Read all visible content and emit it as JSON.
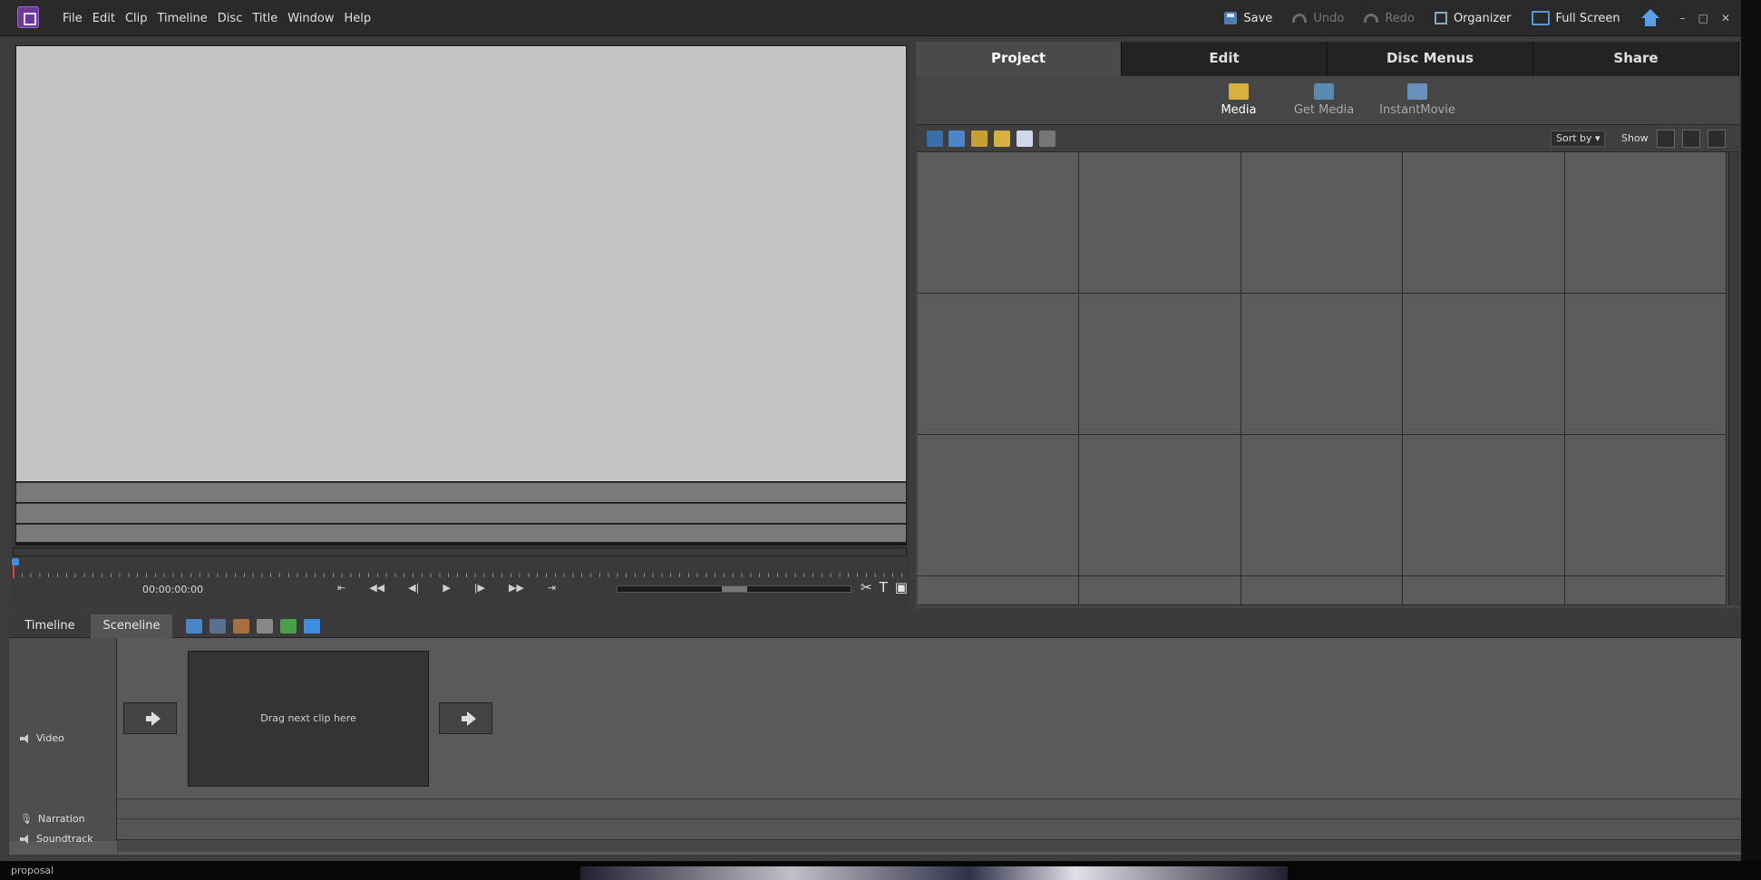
{
  "menu": [
    "File",
    "Edit",
    "Clip",
    "Timeline",
    "Disc",
    "Title",
    "Window",
    "Help"
  ],
  "toolbar": {
    "save": "Save",
    "undo": "Undo",
    "redo": "Redo",
    "organizer": "Organizer",
    "fullscreen": "Full Screen"
  },
  "window_controls": {
    "minimize": "–",
    "restore": "□",
    "close": "✕"
  },
  "monitor": {
    "timecode": "00:00:00:00",
    "transport": [
      "⇤",
      "◀◀",
      "◀|",
      "▶",
      "|▶",
      "▶▶",
      "⇥"
    ],
    "tools": [
      "✂",
      "T",
      "▣"
    ]
  },
  "panel": {
    "tabs": [
      "Project",
      "Edit",
      "Disc Menus",
      "Share"
    ],
    "active_tab": "Project",
    "subtabs": [
      "Media",
      "Get Media",
      "InstantMovie"
    ],
    "active_subtab": "Media",
    "sort_by": "Sort by",
    "show_label": "Show"
  },
  "timeline": {
    "tabs": [
      "Timeline",
      "Sceneline"
    ],
    "active_tab": "Sceneline",
    "tracks": {
      "video": "Video",
      "narration": "Narration",
      "soundtrack": "Soundtrack"
    },
    "drop_hint": "Drag next clip here"
  },
  "status": {
    "text": "proposal"
  },
  "colors": {
    "accent": "#3f8de0",
    "logo": "#6a3a9a",
    "preview_bg": "#c4c4c4"
  }
}
